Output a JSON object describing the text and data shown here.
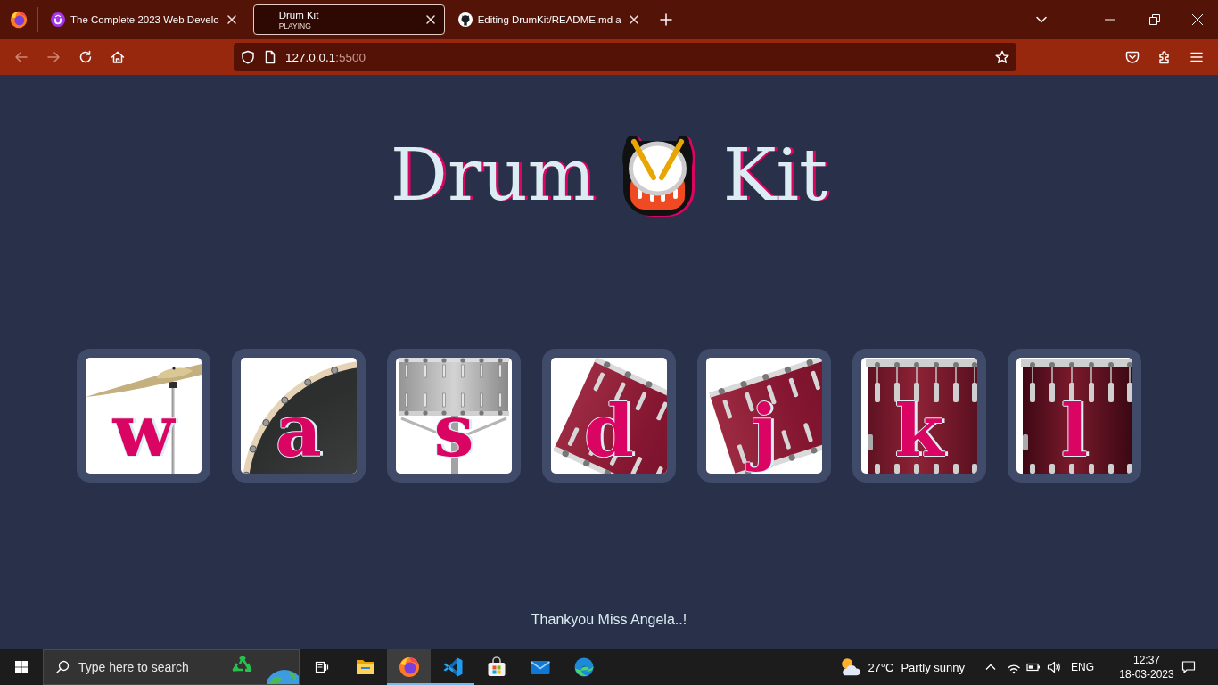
{
  "browser": {
    "tabs": [
      {
        "label": "The Complete 2023 Web Develo",
        "selected": false
      },
      {
        "label": "Drum Kit",
        "status": "PLAYING",
        "selected": true
      },
      {
        "label": "Editing DrumKit/README.md a",
        "selected": false
      }
    ],
    "toolbar": {
      "back": {
        "disabled": true
      },
      "forward": {
        "disabled": true
      }
    },
    "address": {
      "host": "127.0.0.1",
      "port": ":5500"
    }
  },
  "page": {
    "title_start": "Drum",
    "title_end": "Kit",
    "drums": [
      {
        "key": "w",
        "kind": "cymbal"
      },
      {
        "key": "a",
        "kind": "bass"
      },
      {
        "key": "s",
        "kind": "snare"
      },
      {
        "key": "d",
        "kind": "tom"
      },
      {
        "key": "j",
        "kind": "tom"
      },
      {
        "key": "k",
        "kind": "floortom"
      },
      {
        "key": "l",
        "kind": "floortom"
      }
    ],
    "footer": "Thankyou Miss Angela..!"
  },
  "taskbar": {
    "search_placeholder": "Type here to search",
    "apps": [
      {
        "running": false,
        "selected": false
      },
      {
        "running": false,
        "selected": false
      },
      {
        "running": true,
        "selected": true
      },
      {
        "running": true,
        "selected": false
      },
      {
        "running": false,
        "selected": false
      },
      {
        "running": false,
        "selected": false
      },
      {
        "running": false,
        "selected": false
      }
    ],
    "weather": {
      "temperature": "27°C",
      "condition": "Partly sunny"
    },
    "language": "ENG",
    "time": "12:37",
    "date": "18-03-2023"
  }
}
